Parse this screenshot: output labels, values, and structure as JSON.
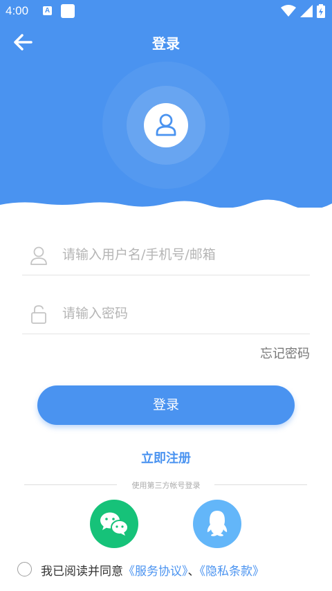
{
  "status_bar": {
    "time": "4:00",
    "a_badge": "A"
  },
  "header": {
    "title": "登录",
    "background_color": "#4a93f0"
  },
  "form": {
    "username_placeholder": "请输入用户名/手机号/邮箱",
    "password_placeholder": "请输入密码",
    "forgot_label": "忘记密码"
  },
  "login_button": {
    "label": "登录"
  },
  "register_link": {
    "label": "立即注册"
  },
  "third_party": {
    "title": "使用第三方帐号登录",
    "providers": [
      {
        "name": "wechat-icon",
        "color": "#16c279"
      },
      {
        "name": "qq-icon",
        "color": "#63b6f9"
      }
    ]
  },
  "agreement": {
    "prefix": "我已阅读并同意",
    "service_link": "《服务协议》",
    "separator": "、",
    "privacy_link": "《隐私条款》",
    "checked": false
  },
  "colors": {
    "accent": "#4a93f0",
    "wechat": "#16c279",
    "qq": "#63b6f9"
  }
}
